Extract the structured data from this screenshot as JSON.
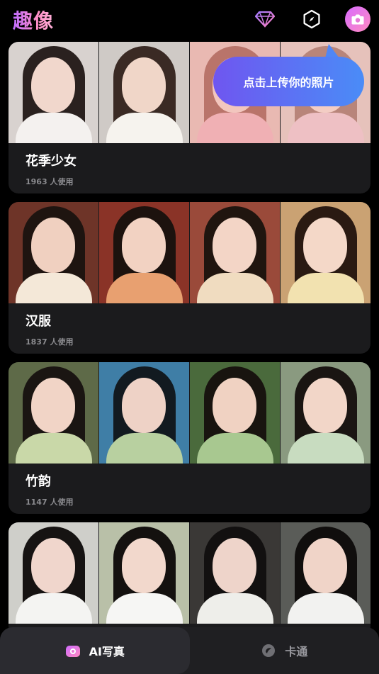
{
  "app": {
    "title": "趣像"
  },
  "header": {
    "icons": [
      "diamond-icon",
      "compass-icon",
      "camera-icon"
    ]
  },
  "tooltip": {
    "text": "点击上传你的照片"
  },
  "cards": [
    {
      "title": "花季少女",
      "usage": "1963 人使用"
    },
    {
      "title": "汉服",
      "usage": "1837 人使用"
    },
    {
      "title": "竹韵",
      "usage": "1147 人使用"
    },
    {
      "title": "",
      "usage": ""
    }
  ],
  "tabs": [
    {
      "label": "AI写真",
      "icon": "camera-icon",
      "active": true
    },
    {
      "label": "卡通",
      "icon": "cartoon-icon",
      "active": false
    }
  ],
  "colors": {
    "accent": "#c06bff",
    "pink": "#ff8ac0",
    "tooltip_start": "#6f56f0",
    "tooltip_end": "#4a8cf7"
  }
}
